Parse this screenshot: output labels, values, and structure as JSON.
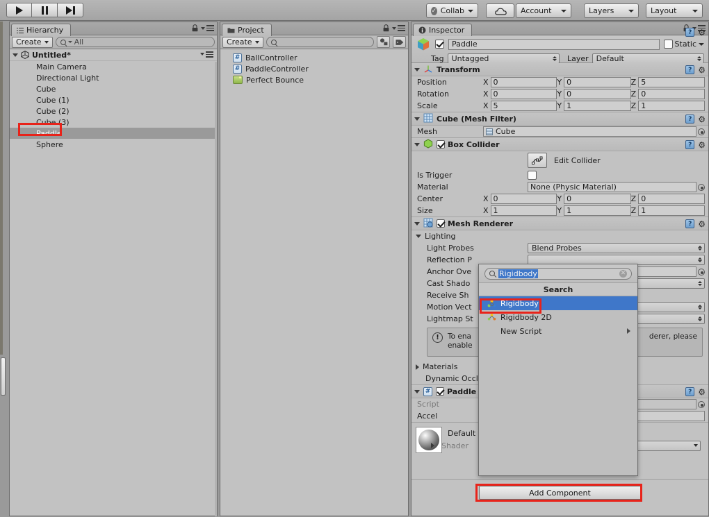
{
  "toolbar": {
    "play_label": "play-icon",
    "pause_label": "pause-icon",
    "step_label": "step-icon",
    "collab": "Collab",
    "cloud": "cloud-icon",
    "account": "Account",
    "layers": "Layers",
    "layout": "Layout"
  },
  "hierarchy": {
    "tab_title": "Hierarchy",
    "create_label": "Create",
    "search_placeholder": "All",
    "search_value": "All",
    "scene_name": "Untitled*",
    "items": [
      {
        "label": "Main Camera",
        "selected": false
      },
      {
        "label": "Directional Light",
        "selected": false
      },
      {
        "label": "Cube",
        "selected": false
      },
      {
        "label": "Cube (1)",
        "selected": false
      },
      {
        "label": "Cube (2)",
        "selected": false
      },
      {
        "label": "Cube (3)",
        "selected": false
      },
      {
        "label": "Paddle",
        "selected": true
      },
      {
        "label": "Sphere",
        "selected": false
      }
    ]
  },
  "project": {
    "tab_title": "Project",
    "create_label": "Create",
    "search_value": "",
    "items": [
      {
        "label": "BallController",
        "icon": "csharp-script-icon"
      },
      {
        "label": "PaddleController",
        "icon": "csharp-script-icon"
      },
      {
        "label": "Perfect Bounce",
        "icon": "scene-icon"
      }
    ]
  },
  "inspector": {
    "tab_title": "Inspector",
    "object_name": "Paddle",
    "object_enabled": true,
    "static_label": "Static",
    "static_checked": false,
    "tag_label": "Tag",
    "tag_value": "Untagged",
    "layer_label": "Layer",
    "layer_value": "Default",
    "components": [
      {
        "title": "Transform",
        "icon": "transform-icon",
        "rows": [
          {
            "label": "Position",
            "x": "0",
            "y": "0",
            "z": "5"
          },
          {
            "label": "Rotation",
            "x": "0",
            "y": "0",
            "z": "0"
          },
          {
            "label": "Scale",
            "x": "5",
            "y": "1",
            "z": "1"
          }
        ]
      },
      {
        "title": "Cube (Mesh Filter)",
        "icon": "mesh-filter-icon",
        "mesh_label": "Mesh",
        "mesh_value": "Cube"
      },
      {
        "title": "Box Collider",
        "icon": "box-collider-icon",
        "enabled": true,
        "edit_collider_label": "Edit Collider",
        "is_trigger_label": "Is Trigger",
        "is_trigger_checked": false,
        "material_label": "Material",
        "material_value": "None (Physic Material)",
        "center": {
          "label": "Center",
          "x": "0",
          "y": "0",
          "z": "0"
        },
        "size": {
          "label": "Size",
          "x": "1",
          "y": "1",
          "z": "1"
        }
      },
      {
        "title": "Mesh Renderer",
        "icon": "mesh-renderer-icon",
        "enabled": true,
        "lighting_label": "Lighting",
        "rows": [
          {
            "label": "Light Probes",
            "value": "Blend Probes",
            "type": "dropdown"
          },
          {
            "label": "Reflection P",
            "value": "",
            "type": "dropdown"
          },
          {
            "label": "Anchor Ove",
            "value": "",
            "type": "object"
          },
          {
            "label": "Cast Shado",
            "value": "",
            "type": "dropdown"
          },
          {
            "label": "Receive Sh",
            "value": "",
            "type": "checkbox"
          },
          {
            "label": "Motion Vect",
            "value": "",
            "type": "dropdown"
          },
          {
            "label": "Lightmap St",
            "value": "",
            "type": "dropdown"
          }
        ],
        "info_text_1": "To ena",
        "info_text_2": "enable",
        "info_text_right_1": "derer, please",
        "materials_label": "Materials",
        "dynamic_occlusion_label": "Dynamic Occlu"
      },
      {
        "title": "Paddle",
        "icon": "csharp-script-icon",
        "enabled": true,
        "script_label": "Script",
        "accel_label": "Accel"
      }
    ],
    "material": {
      "name": "Default",
      "shader_label": "Shader"
    },
    "add_component_label": "Add Component"
  },
  "popup": {
    "search_value": "Rigidbody",
    "title": "Search",
    "items": [
      {
        "label": "Rigidbody",
        "icon": "rigidbody-icon",
        "selected": true,
        "submenu": false
      },
      {
        "label": "Rigidbody 2D",
        "icon": "rigidbody2d-icon",
        "selected": false,
        "submenu": false
      },
      {
        "label": "New Script",
        "icon": "none",
        "selected": false,
        "submenu": true
      }
    ]
  },
  "colors": {
    "accent_blue": "#3f77c9",
    "annotation_red": "#e8231a",
    "panel_bg": "#c2c2c2",
    "chrome_bg": "#9a9a9a"
  }
}
